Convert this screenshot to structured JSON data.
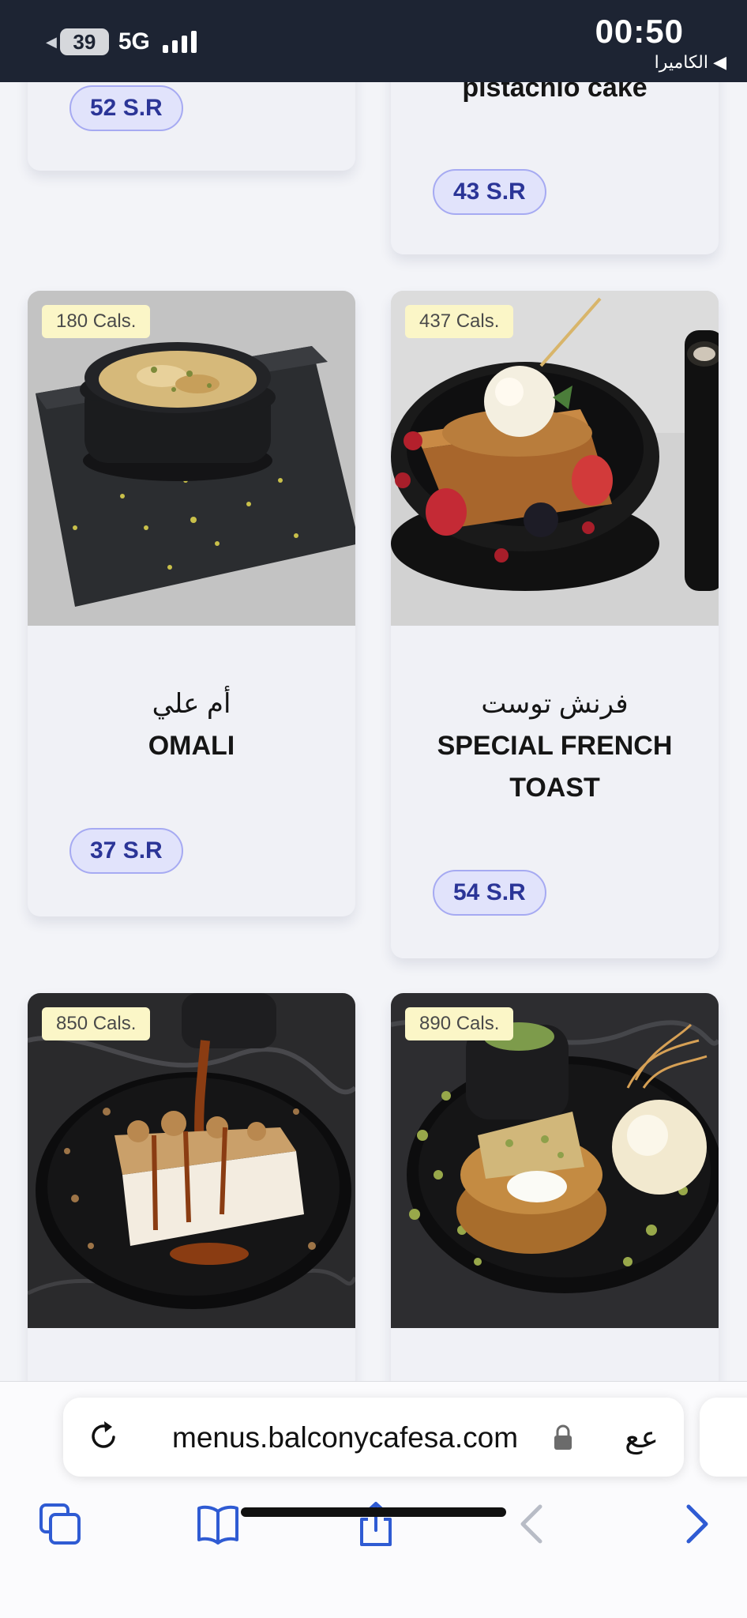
{
  "status_bar": {
    "battery": "39",
    "network": "5G",
    "time": "00:50",
    "back_app": "◀ الكاميرا"
  },
  "menu": {
    "items": [
      {
        "title_ar": "",
        "title_en": "",
        "price": "52 S.R",
        "calories": ""
      },
      {
        "title_ar": "",
        "title_en": "pistachio cake",
        "price": "43 S.R",
        "calories": ""
      },
      {
        "title_ar": "أم علي",
        "title_en": "OMALI",
        "price": "37 S.R",
        "calories": "180 Cals."
      },
      {
        "title_ar": "فرنش توست",
        "title_en": "SPECIAL FRENCH TOAST",
        "price": "54 S.R",
        "calories": "437 Cals."
      },
      {
        "title_ar": "",
        "title_en": "",
        "price": "",
        "calories": "850 Cals."
      },
      {
        "title_ar": "",
        "title_en": "",
        "price": "",
        "calories": "890 Cals."
      }
    ]
  },
  "browser": {
    "url": "menus.balconycafesa.com",
    "text_size_label": "ع‍ع",
    "icons": {
      "reload": "reload-icon",
      "lock": "lock-icon",
      "tabs": "tabs-icon",
      "bookmarks": "bookmarks-icon",
      "share": "share-icon",
      "back": "back-icon",
      "forward": "forward-icon"
    }
  },
  "colors": {
    "status_bar_bg": "#1d2433",
    "price_text": "#2b3597",
    "price_bg": "#e1e3fb",
    "calories_badge": "#fbf6c7",
    "toolbar_accent": "#2f5bd3"
  }
}
